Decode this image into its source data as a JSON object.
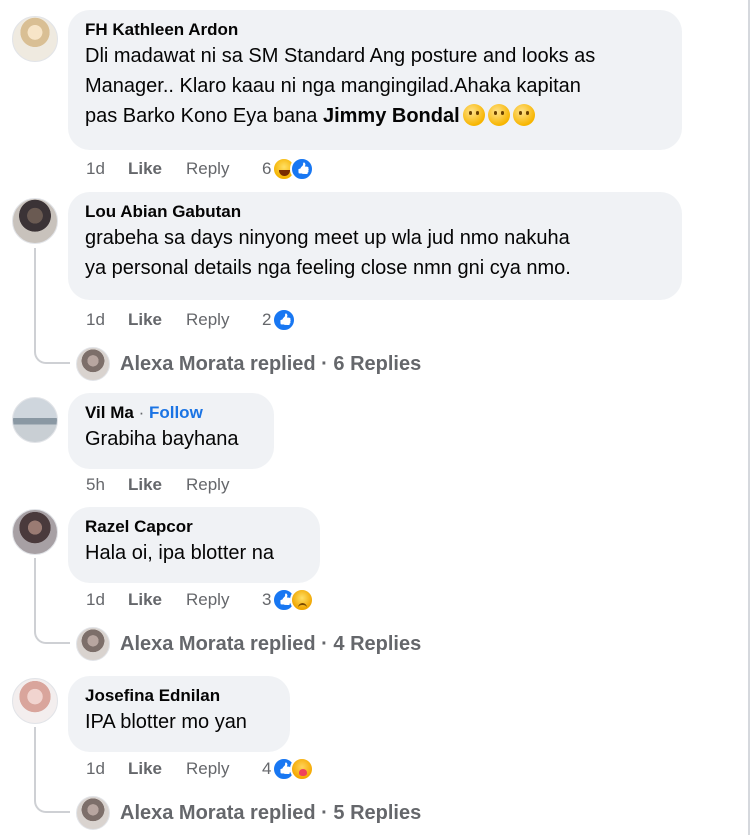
{
  "comments": [
    {
      "author": "FH Kathleen Ardon",
      "text_lines": [
        "Dli madawat ni sa SM Standard Ang posture and looks as",
        "Manager.. Klaro kaau ni nga mangingilad.Ahaka kapitan",
        "pas Barko Kono Eya bana "
      ],
      "mention": "Jimmy Bondal",
      "time": "1d",
      "like": "Like",
      "reply": "Reply",
      "reaction_count": "6",
      "reactions": [
        "haha",
        "like"
      ]
    },
    {
      "author": "Lou Abian Gabutan",
      "text_lines": [
        "grabeha sa days ninyong meet up wla jud nmo nakuha",
        "ya personal details nga feeling close nmn gni cya nmo."
      ],
      "time": "1d",
      "like": "Like",
      "reply": "Reply",
      "reaction_count": "2",
      "reactions": [
        "like"
      ],
      "replies": "Alexa Morata replied · 6 Replies"
    },
    {
      "author": "Vil Ma",
      "follow": "Follow",
      "text_lines": [
        "Grabiha bayhana"
      ],
      "time": "5h",
      "like": "Like",
      "reply": "Reply"
    },
    {
      "author": "Razel Capcor",
      "text_lines": [
        "Hala oi, ipa blotter na"
      ],
      "time": "1d",
      "like": "Like",
      "reply": "Reply",
      "reaction_count": "3",
      "reactions": [
        "like",
        "sad"
      ],
      "replies": "Alexa Morata replied · 4 Replies"
    },
    {
      "author": "Josefina Ednilan",
      "text_lines": [
        "IPA blotter mo yan"
      ],
      "time": "1d",
      "like": "Like",
      "reply": "Reply",
      "reaction_count": "4",
      "reactions": [
        "like",
        "care"
      ],
      "replies": "Alexa Morata replied · 5 Replies"
    }
  ],
  "colors": {
    "bubble": "#f0f2f5",
    "meta_text": "#65676b",
    "follow_link": "#1b74e4",
    "like_reaction": "#1877f2"
  },
  "icons": [
    "haha-reaction-icon",
    "like-reaction-icon",
    "sad-reaction-icon",
    "care-reaction-icon",
    "smile-emoji-icon"
  ]
}
